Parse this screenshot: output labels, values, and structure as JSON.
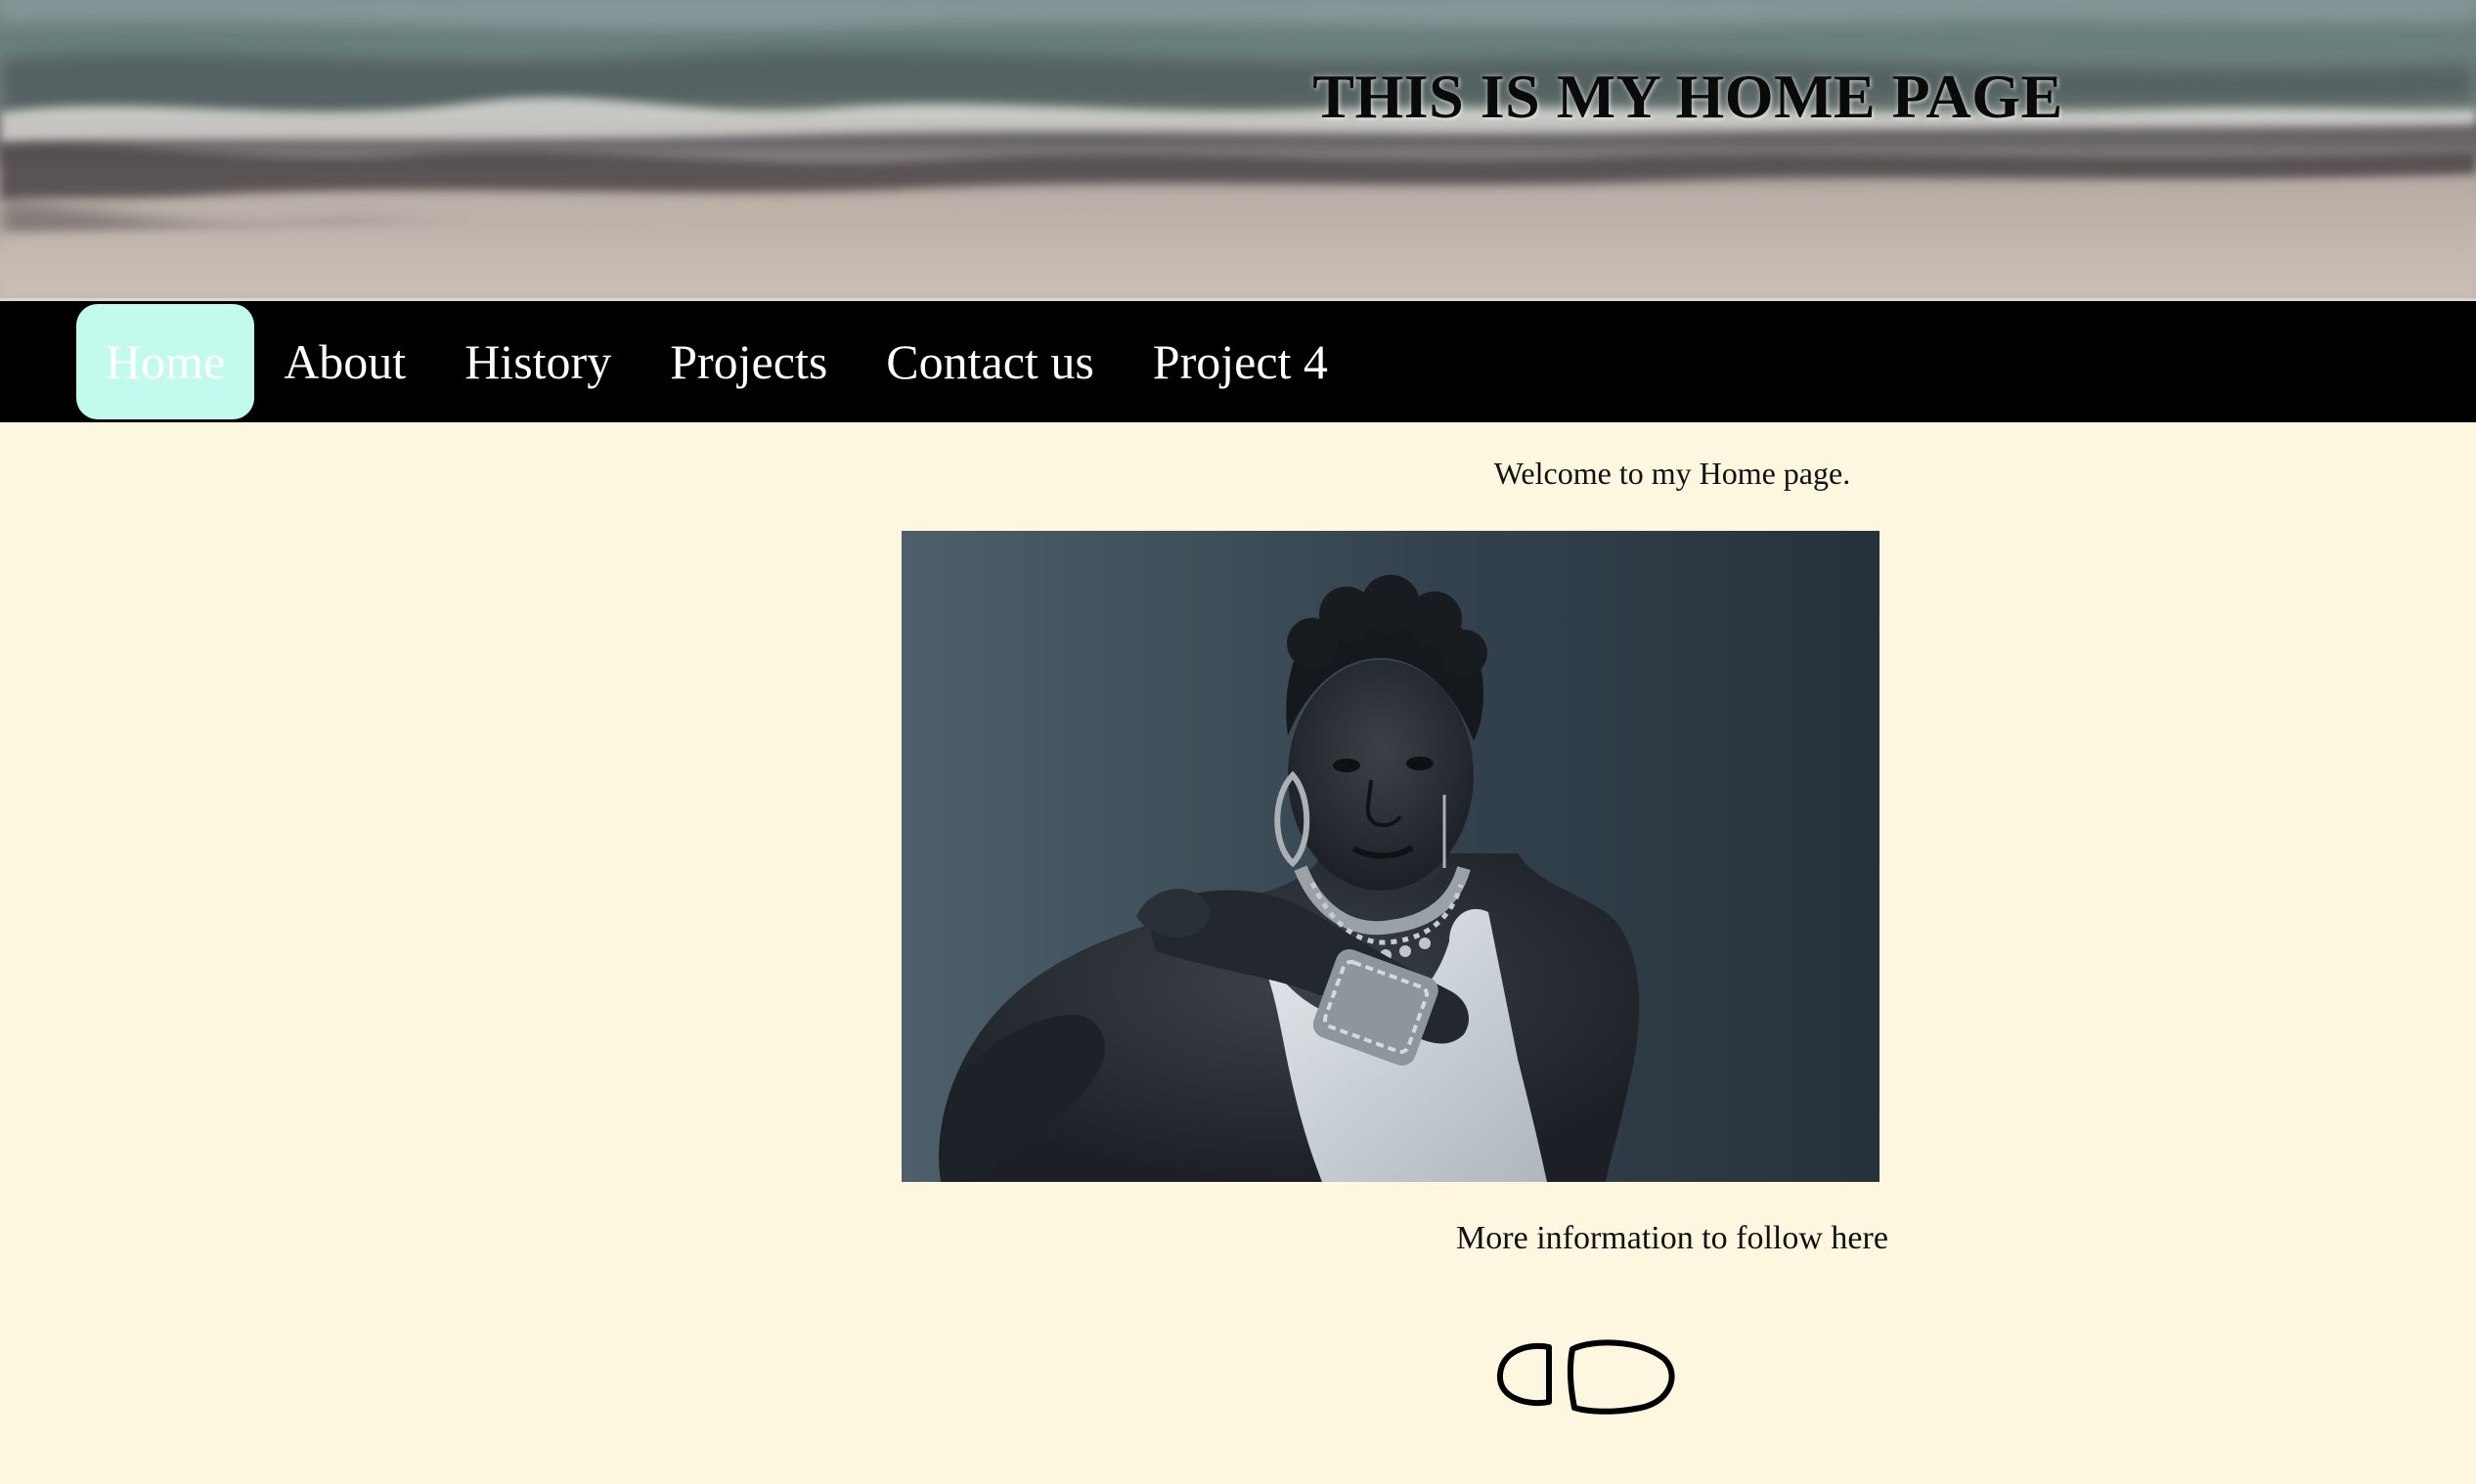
{
  "header": {
    "title": "THIS IS MY HOME PAGE",
    "background_image": "blurred beach shoreline with waves"
  },
  "nav": {
    "items": [
      {
        "label": "Home",
        "active": true
      },
      {
        "label": "About",
        "active": false
      },
      {
        "label": "History",
        "active": false
      },
      {
        "label": "Projects",
        "active": false
      },
      {
        "label": "Contact us",
        "active": false
      },
      {
        "label": "Project 4",
        "active": false
      }
    ],
    "active_color": "#c2fbee",
    "bar_color": "#000000"
  },
  "main": {
    "welcome_text": "Welcome to my Home page.",
    "photo": "black and white portrait of a woman wearing beaded jewelry",
    "more_info_text": "More information to follow here"
  },
  "footer": {
    "logo": "footprints-icon"
  },
  "colors": {
    "page_background": "#fdf7df",
    "text": "#111111"
  }
}
